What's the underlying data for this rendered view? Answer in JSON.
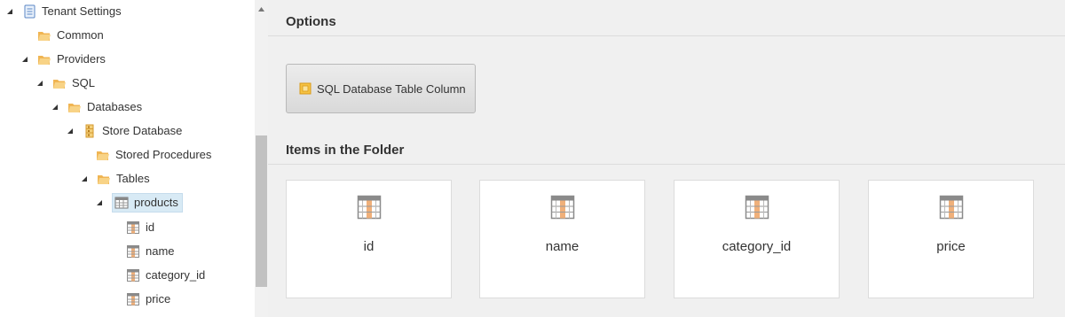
{
  "tree": {
    "nodes": [
      {
        "label": "Tenant Settings",
        "icon": "document-list-icon",
        "expanded": true
      },
      {
        "label": "Common",
        "icon": "folder-open-icon"
      },
      {
        "label": "Providers",
        "icon": "folder-open-icon",
        "expanded": true
      },
      {
        "label": "SQL",
        "icon": "folder-open-icon",
        "expanded": true
      },
      {
        "label": "Databases",
        "icon": "folder-open-icon",
        "expanded": true
      },
      {
        "label": "Store Database",
        "icon": "database-icon",
        "expanded": true
      },
      {
        "label": "Stored Procedures",
        "icon": "folder-open-icon"
      },
      {
        "label": "Tables",
        "icon": "folder-open-icon",
        "expanded": true
      },
      {
        "label": "products",
        "icon": "table-icon",
        "expanded": true,
        "selected": true
      },
      {
        "label": "id",
        "icon": "table-column-icon"
      },
      {
        "label": "name",
        "icon": "table-column-icon"
      },
      {
        "label": "category_id",
        "icon": "table-column-icon"
      },
      {
        "label": "price",
        "icon": "table-column-icon"
      }
    ]
  },
  "options": {
    "title": "Options",
    "button_label": "SQL Database Table Column",
    "button_icon": "sql-column-icon"
  },
  "items": {
    "title": "Items in the Folder",
    "cards": [
      {
        "label": "id",
        "icon": "table-column-icon"
      },
      {
        "label": "name",
        "icon": "table-column-icon"
      },
      {
        "label": "category_id",
        "icon": "table-column-icon"
      },
      {
        "label": "price",
        "icon": "table-column-icon"
      }
    ]
  },
  "colors": {
    "folder": "#f5c26b",
    "selection": "#d8eaf5",
    "content_bg": "#f0f0f0",
    "column_accent": "#e8833a"
  }
}
